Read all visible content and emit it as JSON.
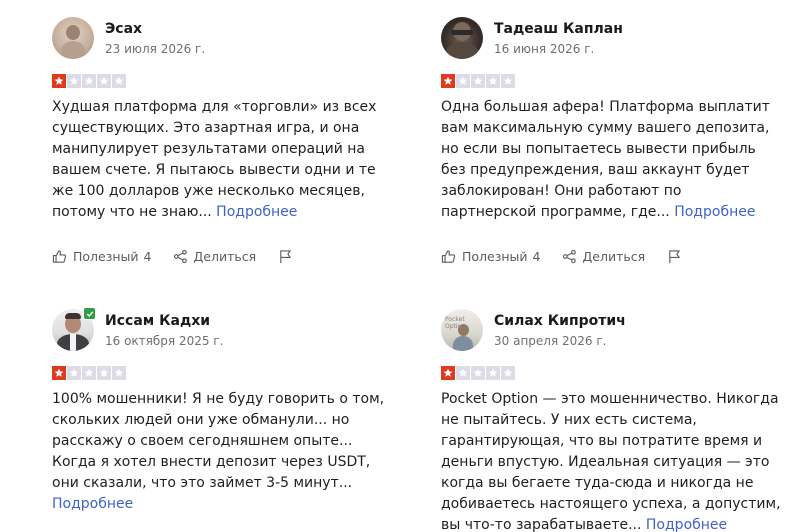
{
  "reviews": [
    {
      "author": "Эсах",
      "date": "23 июля 2026 г.",
      "rating": 1,
      "text": "Худшая платформа для «торговли» из всех существующих. Это азартная игра, и она манипулирует результатами операций на вашем счете. Я пытаюсь вывести одни и те же 100 долларов уже несколько месяцев, потому что не знаю...",
      "more_label": "Подробнее",
      "helpful_label": "Полезный",
      "helpful_count": "4",
      "share_label": "Делиться",
      "verified": false
    },
    {
      "author": "Тадеаш Каплан",
      "date": "16 июня 2026 г.",
      "rating": 1,
      "text": "Одна большая афера! Платформа выплатит вам максимальную сумму вашего депозита, но если вы попытаетесь вывести прибыль без предупреждения, ваш аккаунт будет заблокирован! Они работают по партнерской программе, где...",
      "more_label": "Подробнее",
      "helpful_label": "Полезный",
      "helpful_count": "4",
      "share_label": "Делиться",
      "verified": false
    },
    {
      "author": "Иссам Кадхи",
      "date": "16 октября 2025 г.",
      "rating": 1,
      "text": "100% мошенники! Я не буду говорить о том, скольких людей они уже обманули... но расскажу о своем сегодняшнем опыте... Когда я хотел внести депозит через USDT, они сказали, что это займет 3-5 минут...",
      "more_label": "Подробнее",
      "verified": true
    },
    {
      "author": "Силах Кипротич",
      "date": "30 апреля 2026 г.",
      "rating": 1,
      "text": "Pocket Option — это мошенничество. Никогда не пытайтесь. У них есть система, гарантирующая, что вы потратите время и деньги впустую. Идеальная ситуация — это когда вы бегаете туда-сюда и никогда не добиваетесь настоящего успеха, а допустим, вы что-то зарабатываете...",
      "more_label": "Подробнее",
      "avatar_text": "Pocket Option",
      "verified": false
    }
  ],
  "colors": {
    "star_filled": "#e03a1e",
    "star_empty": "#dcdce6",
    "link": "#3e63c8",
    "verified": "#2f9e44"
  },
  "icons": {
    "helpful": "thumbs-up-icon",
    "share": "share-icon",
    "report": "flag-icon",
    "star": "star-icon",
    "verified": "checkmark-icon"
  }
}
